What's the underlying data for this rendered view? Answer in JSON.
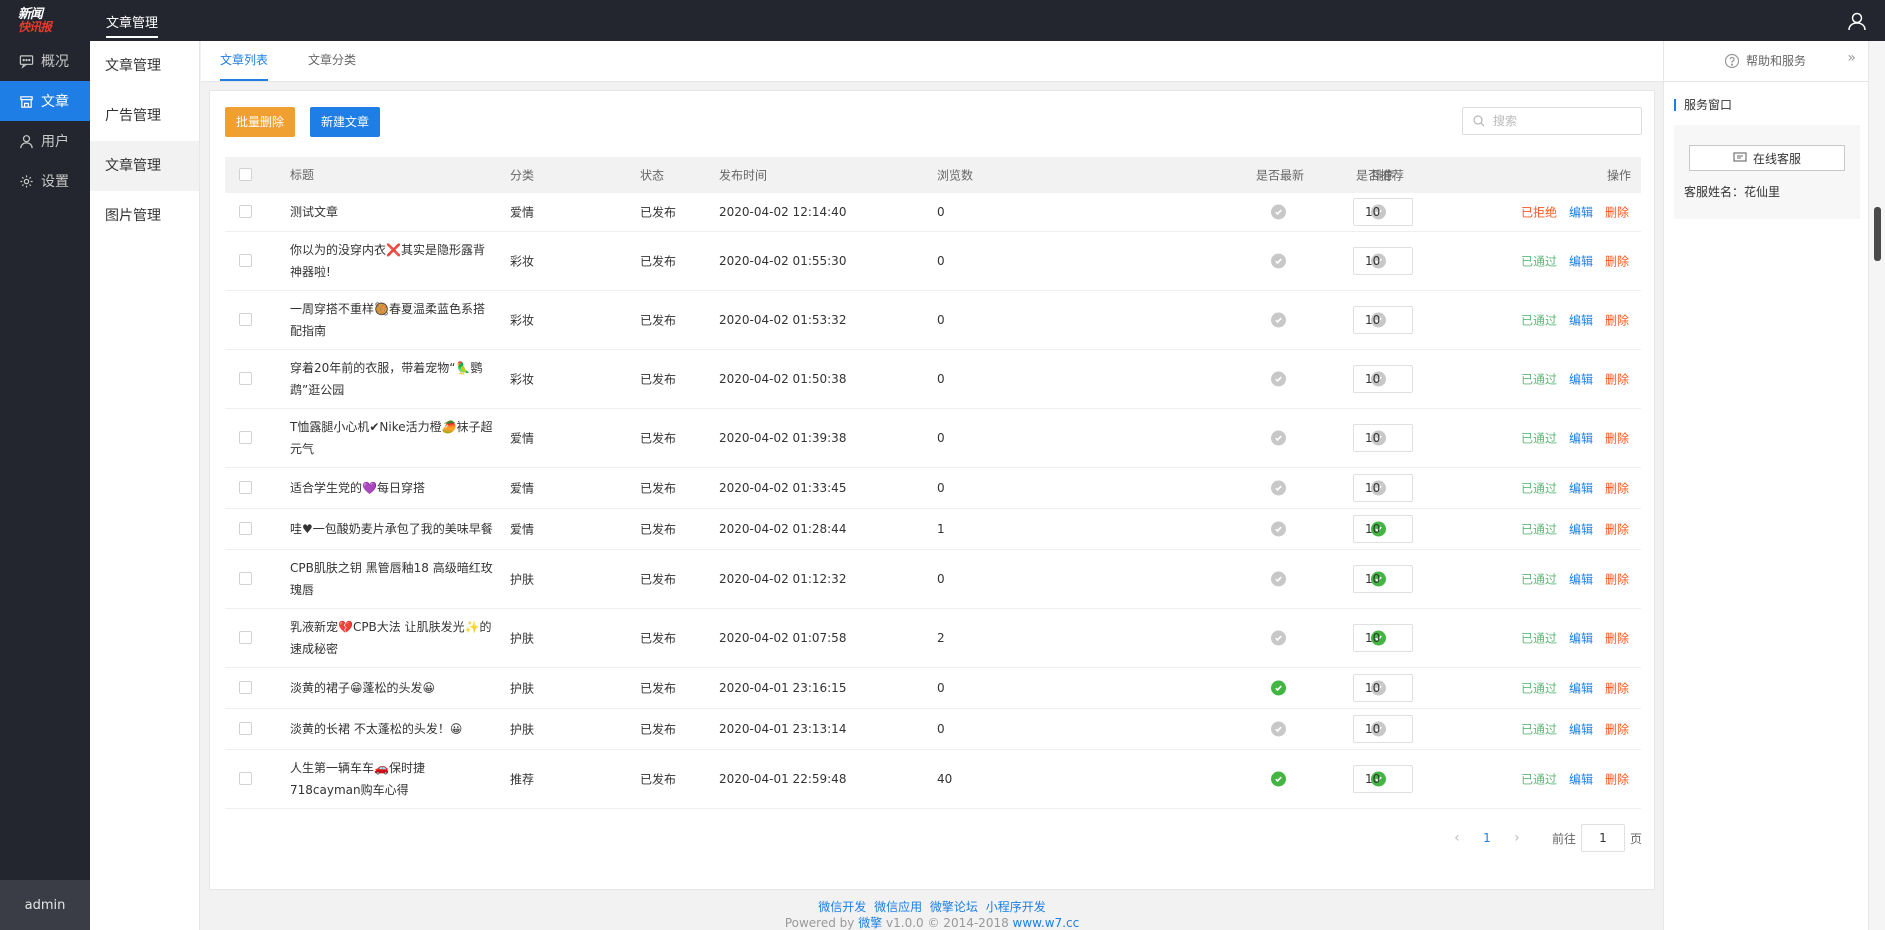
{
  "logo": {
    "line1": "新闻",
    "line2": "快讯报"
  },
  "topbar": {
    "title": "文章管理"
  },
  "leftnav": {
    "items": [
      {
        "label": "概况",
        "icon": "chat-icon"
      },
      {
        "label": "文章",
        "icon": "store-icon",
        "active": true
      },
      {
        "label": "用户",
        "icon": "user-icon"
      },
      {
        "label": "设置",
        "icon": "gear-icon"
      }
    ],
    "admin": "admin"
  },
  "subnav": {
    "items": [
      {
        "label": "文章管理"
      },
      {
        "label": "广告管理"
      },
      {
        "label": "文章管理",
        "active": true
      },
      {
        "label": "图片管理"
      }
    ]
  },
  "tabs": [
    {
      "label": "文章列表",
      "active": true
    },
    {
      "label": "文章分类"
    }
  ],
  "toolbar": {
    "batch_delete": "批量删除",
    "new_article": "新建文章",
    "search_placeholder": "搜索"
  },
  "table": {
    "headers": {
      "title": "标题",
      "category": "分类",
      "status": "状态",
      "time": "发布时间",
      "views": "浏览数",
      "latest": "是否最新",
      "recommend": "是否推荐",
      "sort": "排序",
      "ops": "操作"
    },
    "rows": [
      {
        "title": "测试文章",
        "category": "爱情",
        "status": "已发布",
        "time": "2020-04-02 12:14:40",
        "views": "0",
        "latest": false,
        "recommend": false,
        "sort": "10",
        "review": "已拒绝",
        "review_state": "rejected"
      },
      {
        "title": "你以为的没穿内衣❌其实是隐形露背神器啦!",
        "category": "彩妆",
        "status": "已发布",
        "time": "2020-04-02 01:55:30",
        "views": "0",
        "latest": false,
        "recommend": false,
        "sort": "10",
        "review": "已通过",
        "review_state": "approved"
      },
      {
        "title": "一周穿搭不重样🥘春夏温柔蓝色系搭配指南",
        "category": "彩妆",
        "status": "已发布",
        "time": "2020-04-02 01:53:32",
        "views": "0",
        "latest": false,
        "recommend": false,
        "sort": "10",
        "review": "已通过",
        "review_state": "approved"
      },
      {
        "title": "穿着20年前的衣服，带着宠物“🦜鹦鹉”逛公园",
        "category": "彩妆",
        "status": "已发布",
        "time": "2020-04-02 01:50:38",
        "views": "0",
        "latest": false,
        "recommend": false,
        "sort": "10",
        "review": "已通过",
        "review_state": "approved"
      },
      {
        "title": "T恤露腿小心机✔Nike活力橙🥭袜子超元气",
        "category": "爱情",
        "status": "已发布",
        "time": "2020-04-02 01:39:38",
        "views": "0",
        "latest": false,
        "recommend": false,
        "sort": "10",
        "review": "已通过",
        "review_state": "approved"
      },
      {
        "title": "适合学生党的💜每日穿搭",
        "category": "爱情",
        "status": "已发布",
        "time": "2020-04-02 01:33:45",
        "views": "0",
        "latest": false,
        "recommend": false,
        "sort": "10",
        "review": "已通过",
        "review_state": "approved"
      },
      {
        "title": "哇♥一包酸奶麦片承包了我的美味早餐",
        "category": "爱情",
        "status": "已发布",
        "time": "2020-04-02 01:28:44",
        "views": "1",
        "latest": false,
        "recommend": true,
        "sort": "10",
        "review": "已通过",
        "review_state": "approved"
      },
      {
        "title": "CPB肌肤之钥 黑管唇釉18 高级暗红玫瑰唇",
        "category": "护肤",
        "status": "已发布",
        "time": "2020-04-02 01:12:32",
        "views": "0",
        "latest": false,
        "recommend": true,
        "sort": "10",
        "review": "已通过",
        "review_state": "approved"
      },
      {
        "title": "乳液新宠💔CPB大法 让肌肤发光✨的速成秘密",
        "category": "护肤",
        "status": "已发布",
        "time": "2020-04-02 01:07:58",
        "views": "2",
        "latest": false,
        "recommend": true,
        "sort": "10",
        "review": "已通过",
        "review_state": "approved"
      },
      {
        "title": "淡黄的裙子😁蓬松的头发😀",
        "category": "护肤",
        "status": "已发布",
        "time": "2020-04-01 23:16:15",
        "views": "0",
        "latest": true,
        "recommend": false,
        "sort": "10",
        "review": "已通过",
        "review_state": "approved"
      },
      {
        "title": "淡黄的长裙 不太蓬松的头发！😀",
        "category": "护肤",
        "status": "已发布",
        "time": "2020-04-01 23:13:14",
        "views": "0",
        "latest": false,
        "recommend": false,
        "sort": "10",
        "review": "已通过",
        "review_state": "approved"
      },
      {
        "title": "人生第一辆车车🚗保时捷718cayman购车心得",
        "category": "推荐",
        "status": "已发布",
        "time": "2020-04-01 22:59:48",
        "views": "40",
        "latest": true,
        "recommend": true,
        "sort": "10",
        "review": "已通过",
        "review_state": "approved"
      }
    ],
    "edit_label": "编辑",
    "delete_label": "删除"
  },
  "pager": {
    "current": "1",
    "goto_prefix": "前往",
    "goto_value": "1",
    "goto_suffix": "页"
  },
  "footer": {
    "links": [
      "微信开发",
      "微信应用",
      "微擎论坛",
      "小程序开发"
    ],
    "powered": "Powered by",
    "brand": "微擎",
    "version": "v1.0.0 © 2014-2018",
    "site": "www.w7.cc"
  },
  "rightpanel": {
    "help": "帮助和服务",
    "service_title": "服务窗口",
    "online_service": "在线客服",
    "service_name": "客服姓名：花仙里"
  },
  "colors": {
    "accent": "#1e7ee5",
    "warning": "#f0a030",
    "ok": "#5fb878",
    "danger": "#ff5722",
    "dark": "#23262e"
  }
}
